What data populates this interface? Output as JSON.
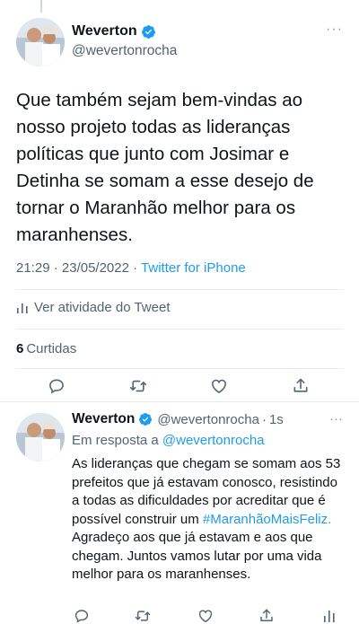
{
  "main_tweet": {
    "author_name": "Weverton",
    "author_handle": "@wevertonrocha",
    "more_label": "···",
    "text": "Que também sejam bem-vindas ao nosso projeto todas as lideranças políticas que junto com Josimar e Detinha se somam a esse desejo de tornar o Maranhão melhor para os maranhenses.",
    "time": "21:29",
    "date": "23/05/2022",
    "source": "Twitter for iPhone",
    "activity_label": "Ver atividade do Tweet",
    "likes_count": "6",
    "likes_label": "Curtidas"
  },
  "reply_tweet": {
    "author_name": "Weverton",
    "author_handle": "@wevertonrocha",
    "time_ago": "1s",
    "more_label": "···",
    "replying_prefix": "Em resposta a",
    "replying_to": "@wevertonrocha",
    "text_part1": "As lideranças que chegam se somam aos 53 prefeitos que já estavam conosco, resistindo a todas as dificuldades por acreditar que é possível construir um",
    "hashtag": "#MaranhãoMaisFeliz.",
    "text_part2": "Agradeço aos que já estavam e aos que chegam. Juntos vamos lutar por uma vida melhor para os maranhenses."
  },
  "colors": {
    "accent": "#1d9bf0",
    "text": "#0f1419",
    "secondary": "#536471",
    "divider": "#e6ecf0"
  },
  "icons": [
    "verified-badge-icon",
    "reply-icon",
    "retweet-icon",
    "like-icon",
    "share-icon",
    "analytics-icon"
  ]
}
